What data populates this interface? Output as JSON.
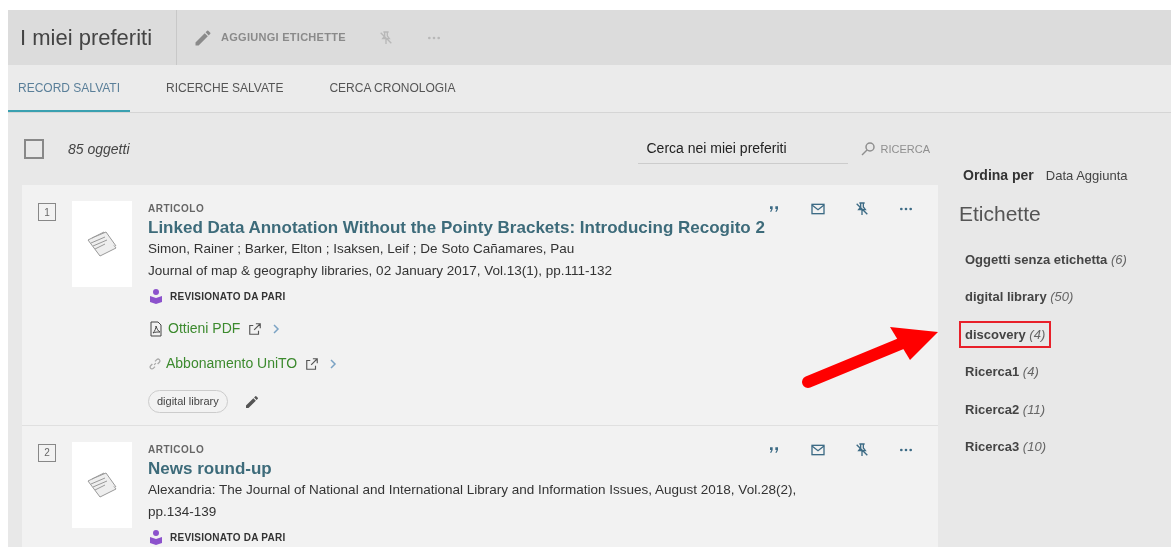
{
  "header": {
    "title": "I miei preferiti",
    "actions": [
      {
        "kind": "pencil",
        "label": "AGGIUNGI ETICHETTE"
      },
      {
        "kind": "unpin"
      },
      {
        "kind": "more"
      }
    ]
  },
  "tabs": [
    {
      "label": "RECORD SALVATI",
      "selected": true
    },
    {
      "label": "RICERCHE SALVATE",
      "selected": false
    },
    {
      "label": "CERCA CRONOLOGIA",
      "selected": false
    }
  ],
  "list_toolbar": {
    "select_all_checked": false,
    "count": "85 oggetti",
    "search": {
      "value": "Cerca nei miei preferiti"
    },
    "search_button": "RICERCA"
  },
  "records": [
    {
      "number": "1",
      "type": "ARTICOLO",
      "title": "Linked Data Annotation Without the Pointy Brackets: Introducing Recogito 2",
      "lines": [
        "Simon, Rainer ; Barker, Elton ; Isaksen, Leif ; De Soto Cañamares, Pau",
        "Journal of map & geography libraries, 02 January 2017, Vol.13(1), pp.111-132"
      ],
      "badge": "REVISIONATO DA PARI",
      "links": [
        {
          "kind": "pdf",
          "label": "Ottieni PDF"
        },
        {
          "kind": "link",
          "label": "Abbonamento UniTO"
        }
      ],
      "tags": [
        "digital library"
      ]
    },
    {
      "number": "2",
      "type": "ARTICOLO",
      "title": "News round-up",
      "lines": [
        "Alexandria: The Journal of National and International Library and Information Issues, August 2018, Vol.28(2),",
        "pp.134-139"
      ],
      "badge": "REVISIONATO DA PARI"
    }
  ],
  "sort": {
    "label": "Ordina per",
    "value": "Data Aggiunta"
  },
  "labels": {
    "title": "Etichette",
    "items": [
      {
        "name": "Oggetti senza etichetta",
        "count": "(6)",
        "highlighted": false
      },
      {
        "name": "digital library",
        "count": "(50)",
        "highlighted": false
      },
      {
        "name": "discovery",
        "count": "(4)",
        "highlighted": true
      },
      {
        "name": "Ricerca1",
        "count": "(4)",
        "highlighted": false
      },
      {
        "name": "Ricerca2",
        "count": "(11)",
        "highlighted": false
      },
      {
        "name": "Ricerca3",
        "count": "(10)",
        "highlighted": false
      }
    ]
  }
}
